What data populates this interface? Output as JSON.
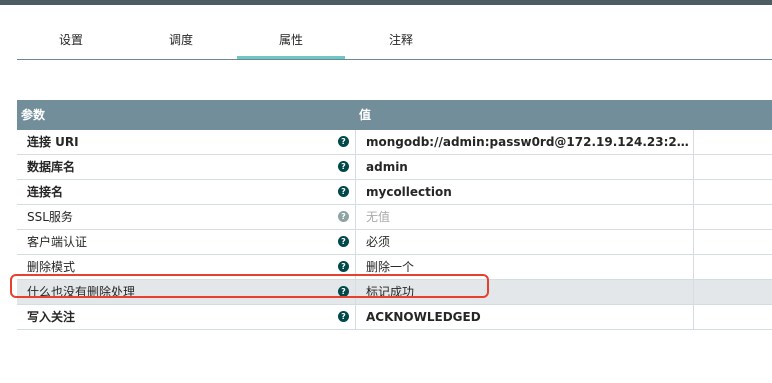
{
  "tabs": [
    {
      "label": "设置",
      "active": false
    },
    {
      "label": "调度",
      "active": false
    },
    {
      "label": "属性",
      "active": true
    },
    {
      "label": "注释",
      "active": false
    }
  ],
  "table": {
    "headers": {
      "param": "参数",
      "value": "值"
    },
    "rows": [
      {
        "name": "连接 URI",
        "value": "mongodb://admin:passw0rd@172.19.124.23:27017/?com...",
        "name_bold": true,
        "value_bold": true,
        "help_icon": "help-icon"
      },
      {
        "name": "数据库名",
        "value": "admin",
        "name_bold": true,
        "value_bold": true,
        "help_icon": "help-icon"
      },
      {
        "name": "连接名",
        "value": "mycollection",
        "name_bold": true,
        "value_bold": true,
        "help_icon": "help-icon"
      },
      {
        "name": "SSL服务",
        "value": "无值",
        "name_bold": false,
        "value_bold": false,
        "help_icon": "help-icon"
      },
      {
        "name": "客户端认证",
        "value": "必须",
        "name_bold": false,
        "value_bold": false,
        "help_icon": "help-icon"
      },
      {
        "name": "删除模式",
        "value": "删除一个",
        "name_bold": false,
        "value_bold": false,
        "help_icon": "help-icon"
      },
      {
        "name": "什么也没有删除处理",
        "value": "标记成功",
        "name_bold": false,
        "value_bold": false,
        "help_icon": "help-icon",
        "highlighted": true
      },
      {
        "name": "写入关注",
        "value": "ACKNOWLEDGED",
        "name_bold": true,
        "value_bold": true,
        "help_icon": "help-icon"
      }
    ]
  },
  "colors": {
    "header_bg": "#728e9b",
    "tab_active_underline": "#6fc6c5",
    "highlight_border": "#e8402e",
    "help_icon": "#004849"
  }
}
